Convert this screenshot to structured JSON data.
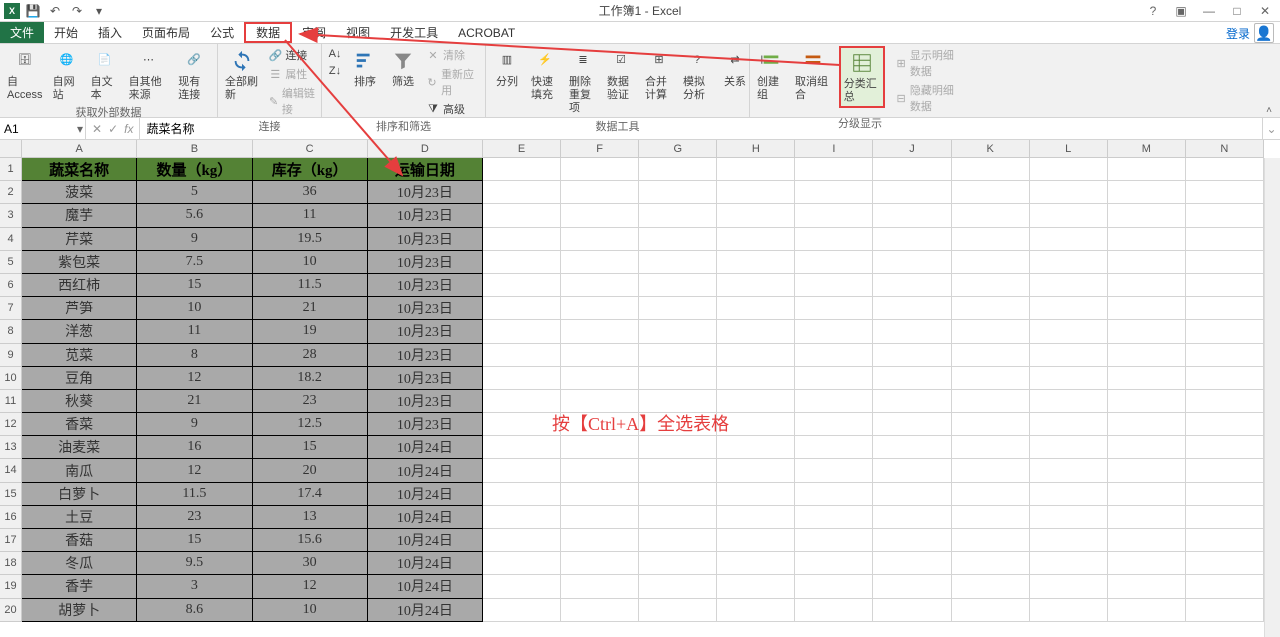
{
  "title": "工作簿1 - Excel",
  "login": "登录",
  "qat": {
    "save": "💾",
    "undo": "↶",
    "redo": "↷"
  },
  "tabs": [
    "文件",
    "开始",
    "插入",
    "页面布局",
    "公式",
    "数据",
    "审阅",
    "视图",
    "开发工具",
    "ACROBAT"
  ],
  "active_tab_index": 5,
  "ribbon": {
    "g1": {
      "label": "获取外部数据",
      "items": [
        "自 Access",
        "自网站",
        "自文本",
        "自其他来源",
        "现有连接"
      ]
    },
    "g2": {
      "label": "连接",
      "refresh": "全部刷新",
      "conn": "连接",
      "prop": "属性",
      "edit": "编辑链接"
    },
    "g3": {
      "label": "排序和筛选",
      "az": "",
      "za": "",
      "sort": "排序",
      "filter": "筛选",
      "clear": "清除",
      "reapply": "重新应用",
      "adv": "高级"
    },
    "g4": {
      "label": "数据工具",
      "split": "分列",
      "flash": "快速填充",
      "dedup": "删除重复项",
      "valid": "数据验证",
      "consol": "合并计算",
      "whatif": "模拟分析",
      "rel": "关系"
    },
    "g5": {
      "label": "分级显示",
      "group": "创建组",
      "ungroup": "取消组合",
      "subtotal": "分类汇总",
      "show": "显示明细数据",
      "hide": "隐藏明细数据"
    }
  },
  "namebox": "A1",
  "formula": "蔬菜名称",
  "col_widths": {
    "data": [
      124,
      124,
      124,
      124
    ],
    "blank": 84
  },
  "col_letters": [
    "A",
    "B",
    "C",
    "D",
    "E",
    "F",
    "G",
    "H",
    "I",
    "J",
    "K",
    "L",
    "M",
    "N"
  ],
  "headers": [
    "蔬菜名称",
    "数量（kg）",
    "库存（kg）",
    "运输日期"
  ],
  "rows": [
    [
      "菠菜",
      "5",
      "36",
      "10月23日"
    ],
    [
      "魔芋",
      "5.6",
      "11",
      "10月23日"
    ],
    [
      "芹菜",
      "9",
      "19.5",
      "10月23日"
    ],
    [
      "紫包菜",
      "7.5",
      "10",
      "10月23日"
    ],
    [
      "西红柿",
      "15",
      "11.5",
      "10月23日"
    ],
    [
      "芦笋",
      "10",
      "21",
      "10月23日"
    ],
    [
      "洋葱",
      "11",
      "19",
      "10月23日"
    ],
    [
      "苋菜",
      "8",
      "28",
      "10月23日"
    ],
    [
      "豆角",
      "12",
      "18.2",
      "10月23日"
    ],
    [
      "秋葵",
      "21",
      "23",
      "10月23日"
    ],
    [
      "香菜",
      "9",
      "12.5",
      "10月23日"
    ],
    [
      "油麦菜",
      "16",
      "15",
      "10月24日"
    ],
    [
      "南瓜",
      "12",
      "20",
      "10月24日"
    ],
    [
      "白萝卜",
      "11.5",
      "17.4",
      "10月24日"
    ],
    [
      "土豆",
      "23",
      "13",
      "10月24日"
    ],
    [
      "香菇",
      "15",
      "15.6",
      "10月24日"
    ],
    [
      "冬瓜",
      "9.5",
      "30",
      "10月24日"
    ],
    [
      "香芋",
      "3",
      "12",
      "10月24日"
    ],
    [
      "胡萝卜",
      "8.6",
      "10",
      "10月24日"
    ]
  ],
  "annotation": "按【Ctrl+A】全选表格"
}
